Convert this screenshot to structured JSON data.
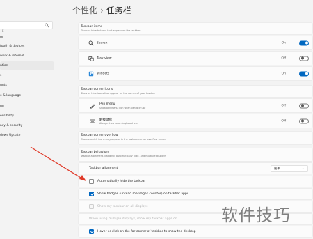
{
  "header": {
    "parent": "个性化",
    "separator": "›",
    "current": "任务栏"
  },
  "sidebar": {
    "search_placeholder": "E",
    "items": [
      {
        "label": "m"
      },
      {
        "label": "tooth & devices"
      },
      {
        "label": "work & internet"
      },
      {
        "label": "ntion"
      },
      {
        "label": "s"
      },
      {
        "label": "unts"
      },
      {
        "label": "e & language"
      },
      {
        "label": "ng"
      },
      {
        "label": "essibility"
      },
      {
        "label": "acy & security"
      },
      {
        "label": "dows Update"
      }
    ]
  },
  "taskbar_items": {
    "title": "Taskbar items",
    "subtitle": "Show or hide buttons that appear on the taskbar",
    "rows": [
      {
        "label": "Search",
        "state": "On",
        "on": true
      },
      {
        "label": "Task view",
        "state": "Off",
        "on": false
      },
      {
        "label": "Widgets",
        "state": "On",
        "on": true
      }
    ]
  },
  "corner_icons": {
    "title": "Taskbar corner icons",
    "subtitle": "Show or hide icons that appear on the corner of your taskbar",
    "rows": [
      {
        "label": "Pen menu",
        "sub": "Show pen menu icon when pen is in use",
        "state": "Off",
        "on": false
      },
      {
        "label": "触摸键盘",
        "sub": "Always show touch keyboard icon",
        "state": "Off",
        "on": false
      }
    ]
  },
  "overflow": {
    "title": "Taskbar corner overflow",
    "subtitle": "Choose which icons may appear in the taskbar corner overflow menu"
  },
  "behaviors": {
    "title": "Taskbar behaviors",
    "subtitle": "Taskbar alignment, badging, automatically hide, and multiple displays",
    "alignment_label": "Taskbar alignment",
    "alignment_value": "居中",
    "options": [
      {
        "label": "Automatically hide the taskbar"
      },
      {
        "label": "Show badges (unread messages counter) on taskbar apps"
      },
      {
        "label": "Show my taskbar on all displays"
      },
      {
        "label": "When using multiple displays, show my taskbar apps on"
      },
      {
        "label": "Hover or click on the far corner of taskbar to show the desktop"
      }
    ]
  },
  "watermark": "软件技巧",
  "colors": {
    "accent": "#0067c0",
    "arrow": "#e03b2a"
  }
}
